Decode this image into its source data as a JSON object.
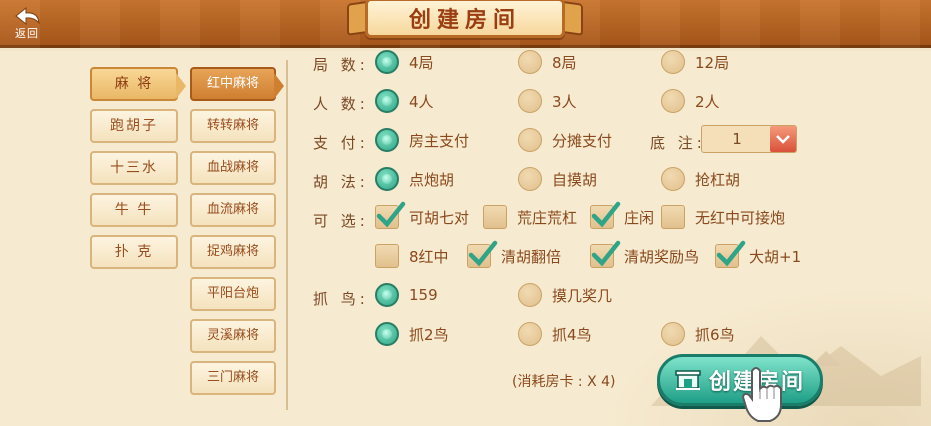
{
  "header": {
    "back_label": "返回",
    "title": "创建房间"
  },
  "categories": [
    {
      "label": "麻 将",
      "active": true
    },
    {
      "label": "跑胡子",
      "active": false
    },
    {
      "label": "十三水",
      "active": false
    },
    {
      "label": "牛 牛",
      "active": false
    },
    {
      "label": "扑 克",
      "active": false
    }
  ],
  "games": [
    {
      "label": "红中麻将",
      "active": true
    },
    {
      "label": "转转麻将",
      "active": false
    },
    {
      "label": "血战麻将",
      "active": false
    },
    {
      "label": "血流麻将",
      "active": false
    },
    {
      "label": "捉鸡麻将",
      "active": false
    },
    {
      "label": "平阳台炮",
      "active": false
    },
    {
      "label": "灵溪麻将",
      "active": false
    },
    {
      "label": "三门麻将",
      "active": false
    }
  ],
  "rows": {
    "rounds": {
      "label": "局 数:",
      "options": [
        "4局",
        "8局",
        "12局"
      ],
      "selected": 0
    },
    "players": {
      "label": "人 数:",
      "options": [
        "4人",
        "3人",
        "2人"
      ],
      "selected": 0
    },
    "payment": {
      "label": "支 付:",
      "options": [
        "房主支付",
        "分摊支付"
      ],
      "selected": 0
    },
    "base": {
      "label": "底 注:",
      "value": "1"
    },
    "win": {
      "label": "胡 法:",
      "options": [
        "点炮胡",
        "自摸胡",
        "抢杠胡"
      ],
      "selected": 0
    },
    "optional": {
      "label": "可 选:",
      "items": [
        {
          "text": "可胡七对",
          "checked": true
        },
        {
          "text": "荒庄荒杠",
          "checked": false
        },
        {
          "text": "庄闲",
          "checked": true
        },
        {
          "text": "无红中可接炮",
          "checked": false
        },
        {
          "text": "8红中",
          "checked": false
        },
        {
          "text": "清胡翻倍",
          "checked": true
        },
        {
          "text": "清胡奖励鸟",
          "checked": true
        },
        {
          "text": "大胡+1",
          "checked": true
        }
      ]
    },
    "birds": {
      "label": "抓 鸟:",
      "options": [
        "159",
        "摸几奖几",
        "抓2鸟",
        "抓4鸟",
        "抓6鸟"
      ],
      "selected": [
        0,
        2
      ]
    }
  },
  "footer": {
    "cost_note": "(消耗房卡 : X 4)",
    "create_label": "创建房间"
  },
  "colors": {
    "accent_green": "#2fa487",
    "header_brown": "#a9571a",
    "text_brown": "#8a4a1d"
  }
}
